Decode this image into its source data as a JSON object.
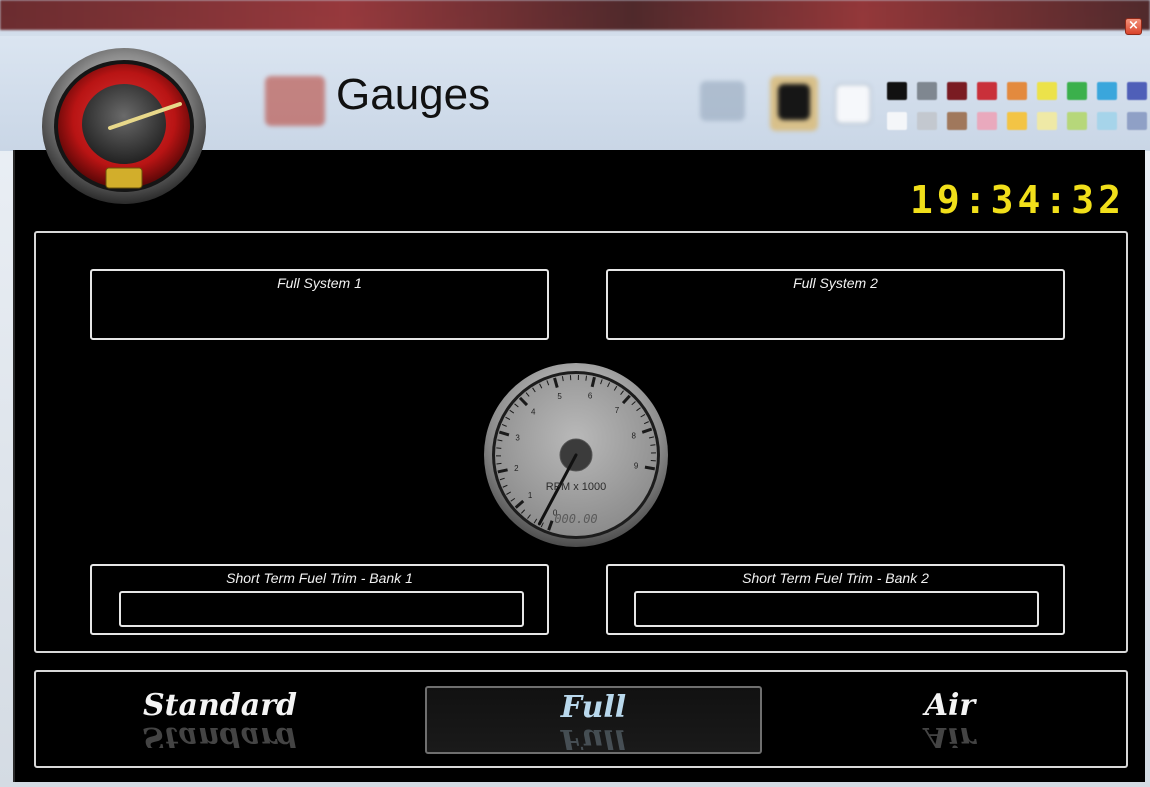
{
  "window": {
    "title": "Gauges",
    "close_glyph": "×"
  },
  "clock": {
    "time": "19:34:32",
    "color": "#f1df1a"
  },
  "logo": {
    "icon": "speedometer-icon"
  },
  "panels": {
    "full_system_1": {
      "title": "Full System 1"
    },
    "full_system_2": {
      "title": "Full System 2"
    },
    "stft_bank_1": {
      "title": "Short Term Fuel Trim - Bank 1"
    },
    "stft_bank_2": {
      "title": "Short Term Fuel Trim - Bank 2"
    }
  },
  "rpm_gauge": {
    "label": "RPM x 1000",
    "readout": "000.00",
    "scale_labels": [
      "0",
      "1",
      "2",
      "3",
      "4",
      "5",
      "6",
      "7",
      "8",
      "9"
    ],
    "value": 0
  },
  "modes": {
    "items": [
      {
        "label": "Standard",
        "active": false
      },
      {
        "label": "Full",
        "active": true
      },
      {
        "label": "Air",
        "active": false
      }
    ]
  }
}
